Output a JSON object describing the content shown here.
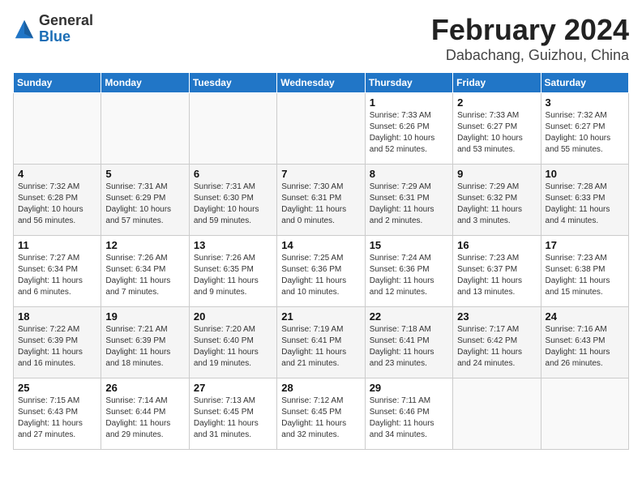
{
  "header": {
    "logo_general": "General",
    "logo_blue": "Blue",
    "month": "February 2024",
    "location": "Dabachang, Guizhou, China"
  },
  "weekdays": [
    "Sunday",
    "Monday",
    "Tuesday",
    "Wednesday",
    "Thursday",
    "Friday",
    "Saturday"
  ],
  "weeks": [
    [
      {
        "day": "",
        "info": ""
      },
      {
        "day": "",
        "info": ""
      },
      {
        "day": "",
        "info": ""
      },
      {
        "day": "",
        "info": ""
      },
      {
        "day": "1",
        "info": "Sunrise: 7:33 AM\nSunset: 6:26 PM\nDaylight: 10 hours\nand 52 minutes."
      },
      {
        "day": "2",
        "info": "Sunrise: 7:33 AM\nSunset: 6:27 PM\nDaylight: 10 hours\nand 53 minutes."
      },
      {
        "day": "3",
        "info": "Sunrise: 7:32 AM\nSunset: 6:27 PM\nDaylight: 10 hours\nand 55 minutes."
      }
    ],
    [
      {
        "day": "4",
        "info": "Sunrise: 7:32 AM\nSunset: 6:28 PM\nDaylight: 10 hours\nand 56 minutes."
      },
      {
        "day": "5",
        "info": "Sunrise: 7:31 AM\nSunset: 6:29 PM\nDaylight: 10 hours\nand 57 minutes."
      },
      {
        "day": "6",
        "info": "Sunrise: 7:31 AM\nSunset: 6:30 PM\nDaylight: 10 hours\nand 59 minutes."
      },
      {
        "day": "7",
        "info": "Sunrise: 7:30 AM\nSunset: 6:31 PM\nDaylight: 11 hours\nand 0 minutes."
      },
      {
        "day": "8",
        "info": "Sunrise: 7:29 AM\nSunset: 6:31 PM\nDaylight: 11 hours\nand 2 minutes."
      },
      {
        "day": "9",
        "info": "Sunrise: 7:29 AM\nSunset: 6:32 PM\nDaylight: 11 hours\nand 3 minutes."
      },
      {
        "day": "10",
        "info": "Sunrise: 7:28 AM\nSunset: 6:33 PM\nDaylight: 11 hours\nand 4 minutes."
      }
    ],
    [
      {
        "day": "11",
        "info": "Sunrise: 7:27 AM\nSunset: 6:34 PM\nDaylight: 11 hours\nand 6 minutes."
      },
      {
        "day": "12",
        "info": "Sunrise: 7:26 AM\nSunset: 6:34 PM\nDaylight: 11 hours\nand 7 minutes."
      },
      {
        "day": "13",
        "info": "Sunrise: 7:26 AM\nSunset: 6:35 PM\nDaylight: 11 hours\nand 9 minutes."
      },
      {
        "day": "14",
        "info": "Sunrise: 7:25 AM\nSunset: 6:36 PM\nDaylight: 11 hours\nand 10 minutes."
      },
      {
        "day": "15",
        "info": "Sunrise: 7:24 AM\nSunset: 6:36 PM\nDaylight: 11 hours\nand 12 minutes."
      },
      {
        "day": "16",
        "info": "Sunrise: 7:23 AM\nSunset: 6:37 PM\nDaylight: 11 hours\nand 13 minutes."
      },
      {
        "day": "17",
        "info": "Sunrise: 7:23 AM\nSunset: 6:38 PM\nDaylight: 11 hours\nand 15 minutes."
      }
    ],
    [
      {
        "day": "18",
        "info": "Sunrise: 7:22 AM\nSunset: 6:39 PM\nDaylight: 11 hours\nand 16 minutes."
      },
      {
        "day": "19",
        "info": "Sunrise: 7:21 AM\nSunset: 6:39 PM\nDaylight: 11 hours\nand 18 minutes."
      },
      {
        "day": "20",
        "info": "Sunrise: 7:20 AM\nSunset: 6:40 PM\nDaylight: 11 hours\nand 19 minutes."
      },
      {
        "day": "21",
        "info": "Sunrise: 7:19 AM\nSunset: 6:41 PM\nDaylight: 11 hours\nand 21 minutes."
      },
      {
        "day": "22",
        "info": "Sunrise: 7:18 AM\nSunset: 6:41 PM\nDaylight: 11 hours\nand 23 minutes."
      },
      {
        "day": "23",
        "info": "Sunrise: 7:17 AM\nSunset: 6:42 PM\nDaylight: 11 hours\nand 24 minutes."
      },
      {
        "day": "24",
        "info": "Sunrise: 7:16 AM\nSunset: 6:43 PM\nDaylight: 11 hours\nand 26 minutes."
      }
    ],
    [
      {
        "day": "25",
        "info": "Sunrise: 7:15 AM\nSunset: 6:43 PM\nDaylight: 11 hours\nand 27 minutes."
      },
      {
        "day": "26",
        "info": "Sunrise: 7:14 AM\nSunset: 6:44 PM\nDaylight: 11 hours\nand 29 minutes."
      },
      {
        "day": "27",
        "info": "Sunrise: 7:13 AM\nSunset: 6:45 PM\nDaylight: 11 hours\nand 31 minutes."
      },
      {
        "day": "28",
        "info": "Sunrise: 7:12 AM\nSunset: 6:45 PM\nDaylight: 11 hours\nand 32 minutes."
      },
      {
        "day": "29",
        "info": "Sunrise: 7:11 AM\nSunset: 6:46 PM\nDaylight: 11 hours\nand 34 minutes."
      },
      {
        "day": "",
        "info": ""
      },
      {
        "day": "",
        "info": ""
      }
    ]
  ]
}
